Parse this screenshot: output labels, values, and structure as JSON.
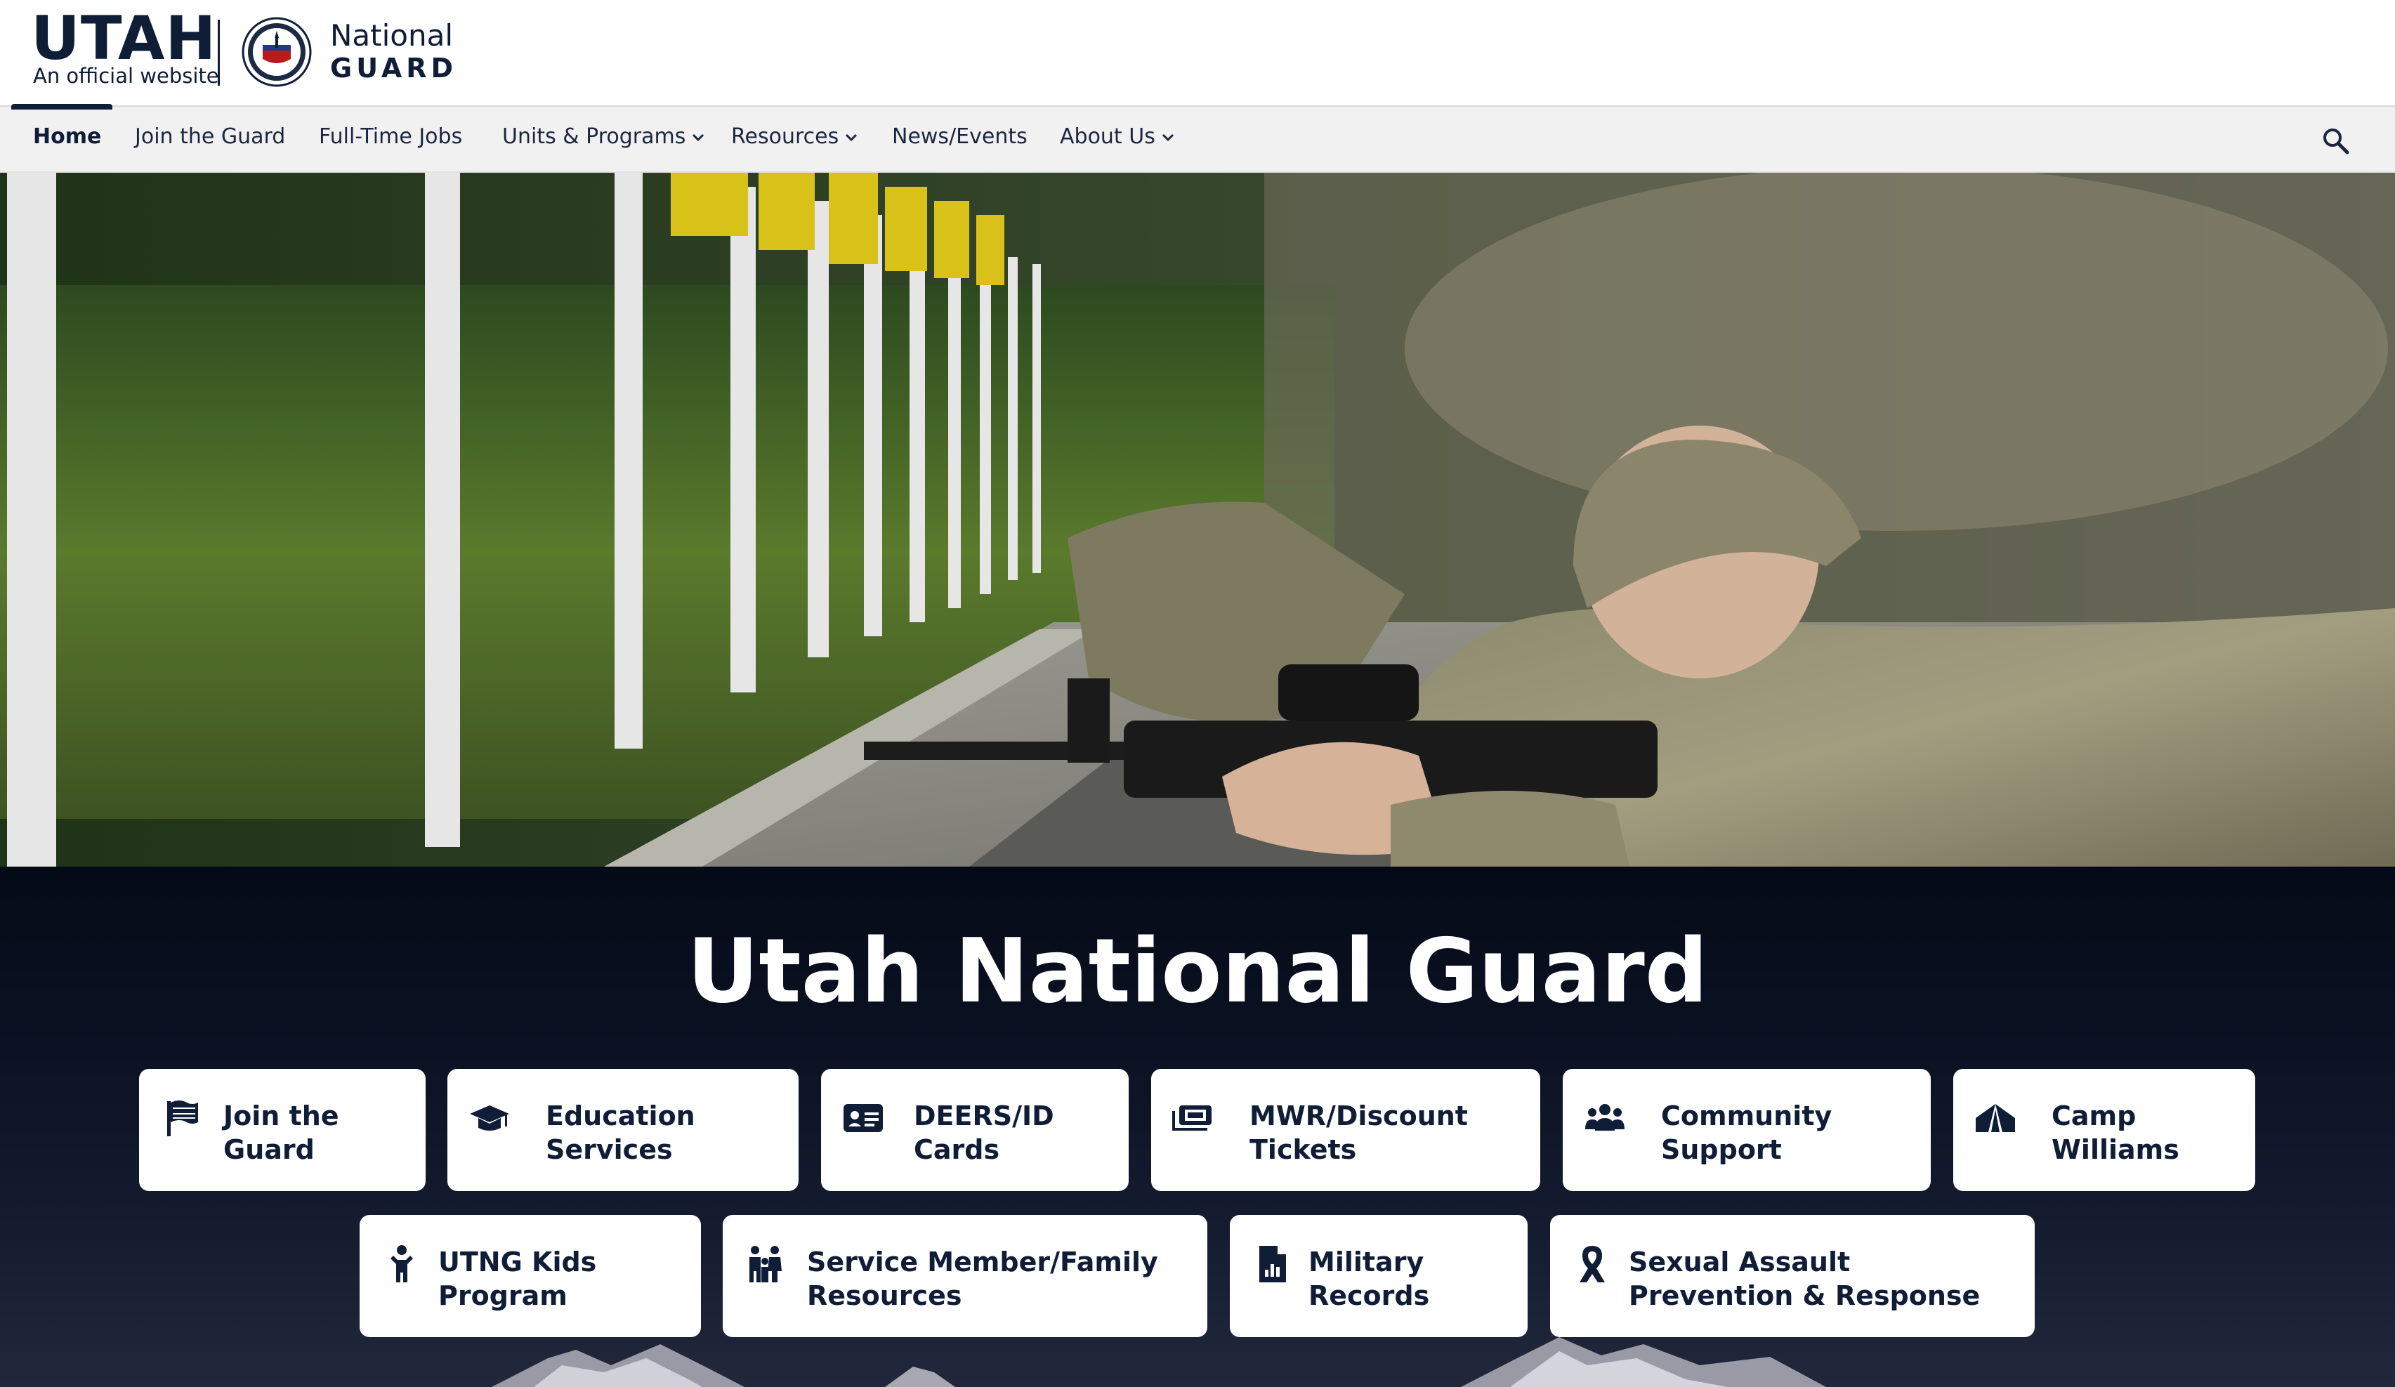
{
  "header": {
    "utah_word": "UTAH",
    "official_text": "An official website",
    "agency_line1": "National",
    "agency_line2": "GUARD"
  },
  "nav": {
    "items": [
      {
        "label": "Home",
        "active": true,
        "dropdown": false
      },
      {
        "label": "Join the Guard",
        "active": false,
        "dropdown": false
      },
      {
        "label": "Full-Time Jobs",
        "active": false,
        "dropdown": false
      },
      {
        "label": "Units & Programs",
        "active": false,
        "dropdown": true
      },
      {
        "label": "Resources",
        "active": false,
        "dropdown": true
      },
      {
        "label": "News/Events",
        "active": false,
        "dropdown": false
      },
      {
        "label": "About Us",
        "active": false,
        "dropdown": true
      }
    ],
    "search_icon": "search-icon"
  },
  "hero": {
    "image": "soldiers-firing-range-photo"
  },
  "main": {
    "title": "Utah National Guard",
    "quick_links": [
      {
        "label": "Join the Guard",
        "icon": "flag-icon"
      },
      {
        "label": "Education Services",
        "icon": "graduation-cap-icon"
      },
      {
        "label": "DEERS/ID Cards",
        "icon": "id-card-icon"
      },
      {
        "label": "MWR/Discount Tickets",
        "icon": "tickets-icon"
      },
      {
        "label": "Community Support",
        "icon": "people-group-icon"
      },
      {
        "label": "Camp Williams",
        "icon": "tent-icon"
      },
      {
        "label": "UTNG Kids Program",
        "icon": "child-icon"
      },
      {
        "label": "Service Member/Family Resources",
        "icon": "family-icon"
      },
      {
        "label": "Military Records",
        "icon": "file-chart-icon"
      },
      {
        "label": "Sexual Assault Prevention & Response",
        "icon": "ribbon-icon"
      }
    ]
  },
  "colors": {
    "brand_navy": "#0f1d37",
    "nav_bg": "#f1f1f1",
    "band_dark": "#050a17",
    "tile_bg": "#ffffff"
  }
}
